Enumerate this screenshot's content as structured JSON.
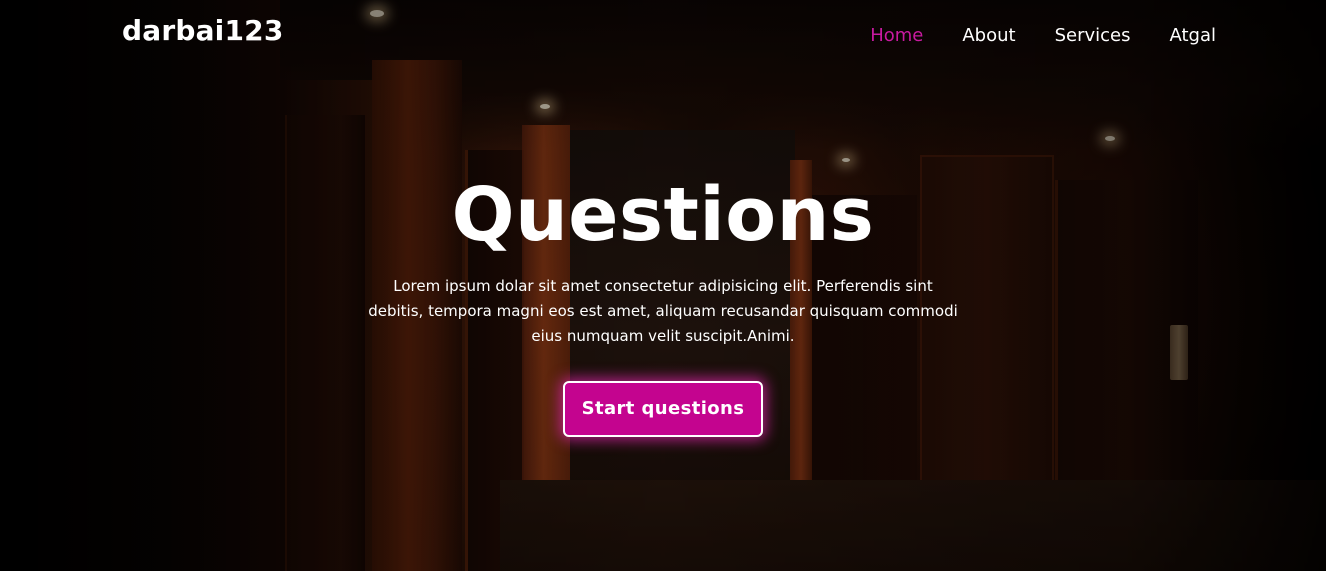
{
  "brand": {
    "name": "darbai123"
  },
  "nav": {
    "items": [
      {
        "label": "Home",
        "active": true
      },
      {
        "label": "About",
        "active": false
      },
      {
        "label": "Services",
        "active": false
      },
      {
        "label": "Atgal",
        "active": false
      }
    ]
  },
  "hero": {
    "title": "Questions",
    "description": "Lorem ipsum dolar sit amet consectetur adipisicing elit. Perferendis sint debitis, tempora magni eos est amet, aliquam recusandar quisquam commodi eius numquam velit suscipit.Animi.",
    "cta_label": "Start questions",
    "background": "dark hotel hallway photo"
  },
  "colors": {
    "accent": "#c4048f",
    "active_nav": "#c81aa0",
    "text": "#ffffff"
  }
}
